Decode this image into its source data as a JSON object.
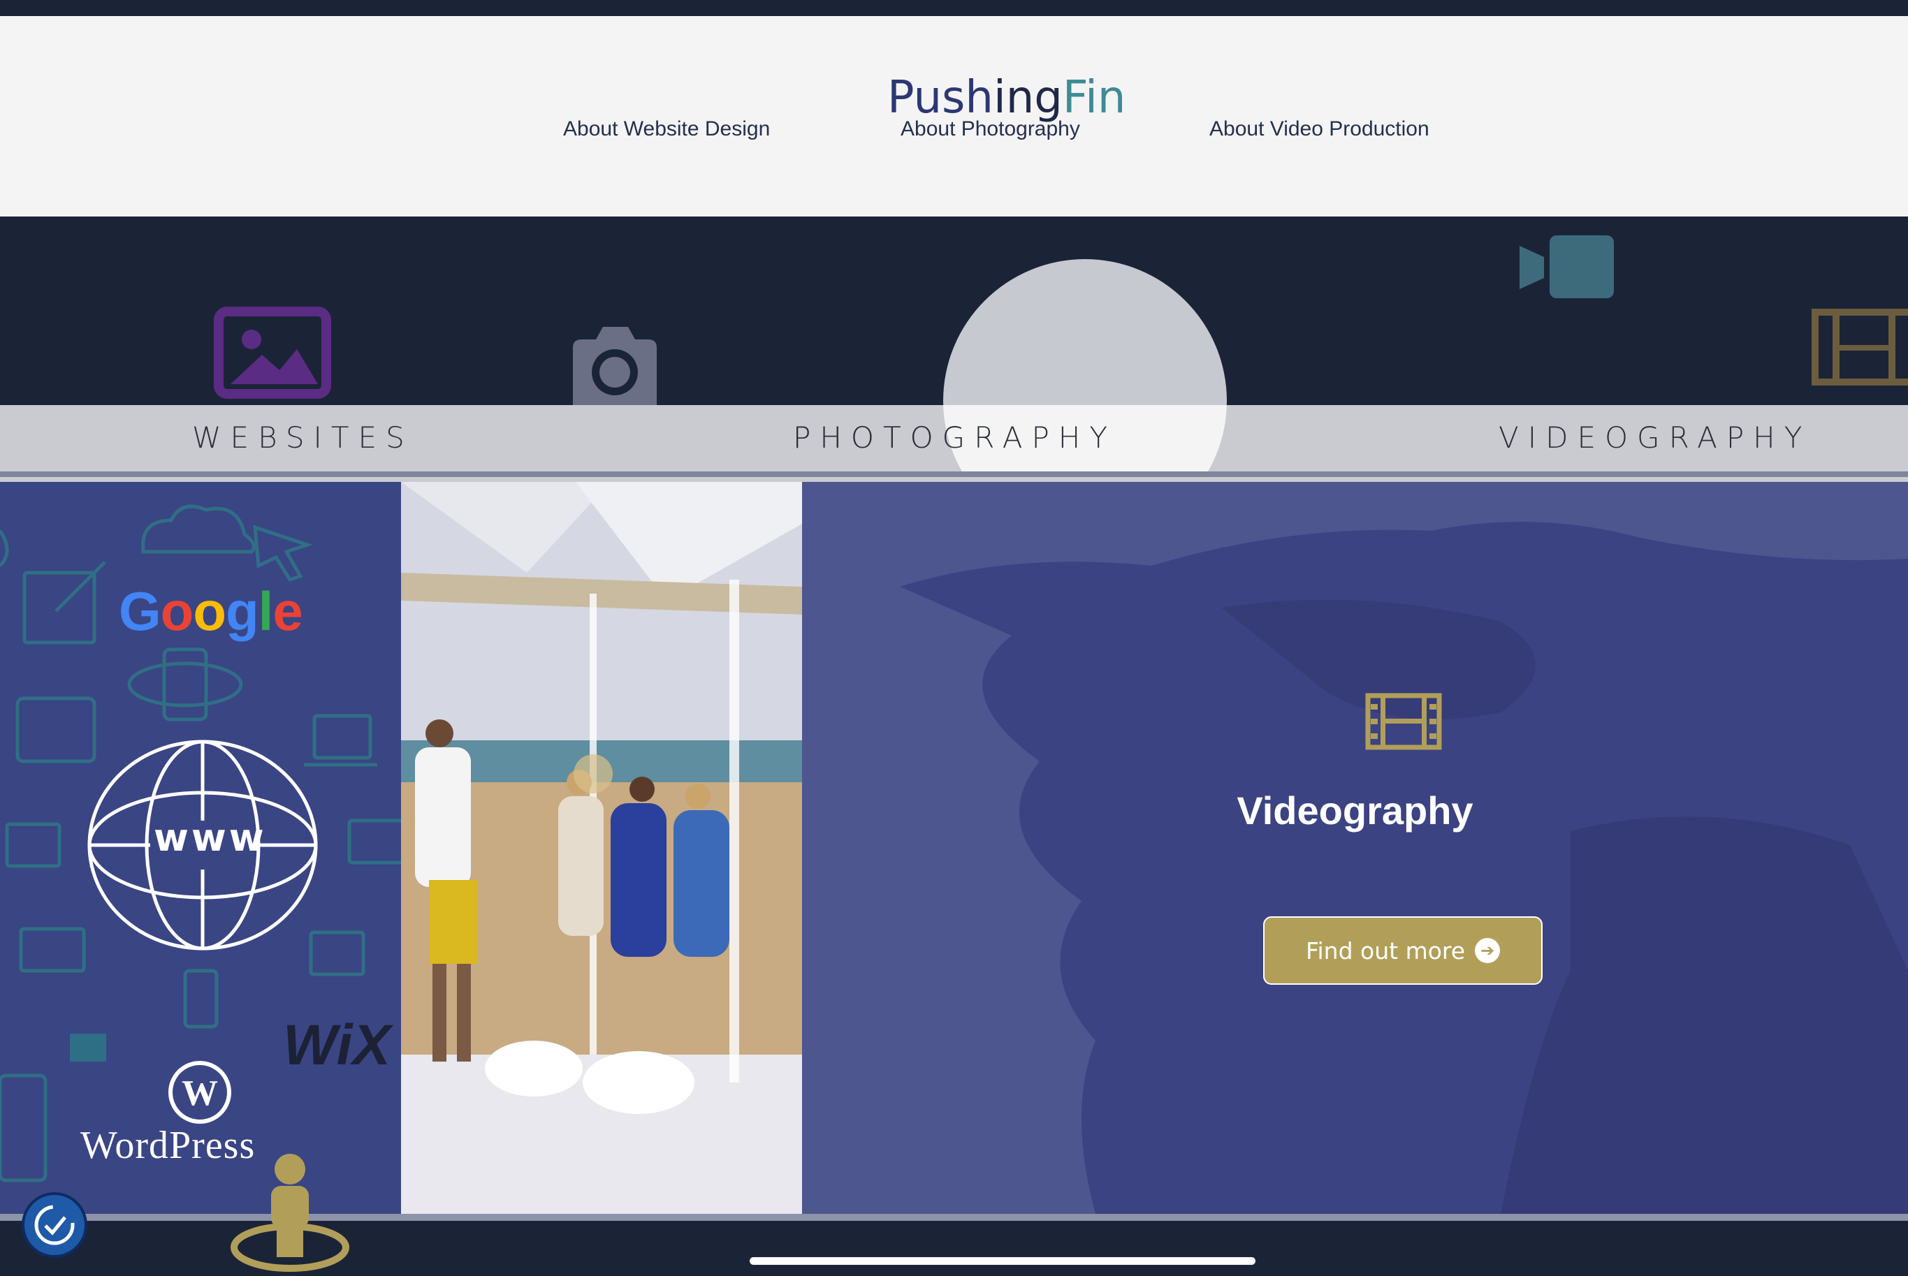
{
  "nav": {
    "links": [
      "About Website Design",
      "About Photography",
      "About Video Production"
    ]
  },
  "hero": {
    "logo_part1": "Push",
    "logo_part2": "ing",
    "logo_part3": "Fin"
  },
  "tabs": {
    "websites": "WEBSITES",
    "photography": "PHOTOGRAPHY",
    "videography": "VIDEOGRAPHY"
  },
  "websites_panel": {
    "google": [
      "G",
      "o",
      "o",
      "g",
      "l",
      "e"
    ],
    "google_colors": [
      "#4285f4",
      "#ea4335",
      "#fbbc05",
      "#4285f4",
      "#34a853",
      "#ea4335"
    ],
    "www": "www",
    "wix": "WiX",
    "wordpress": "WordPress"
  },
  "videography_panel": {
    "title": "Videography",
    "button_label": "Find out more"
  },
  "colors": {
    "navy": "#1b2437",
    "gold": "#b19f59",
    "panel_web": "#3a4584",
    "panel_video": "#4e5690"
  },
  "icons": [
    "image-icon",
    "camera-icon",
    "video-camera-icon",
    "film-icon",
    "accessibility-icon",
    "person-pin-icon"
  ]
}
